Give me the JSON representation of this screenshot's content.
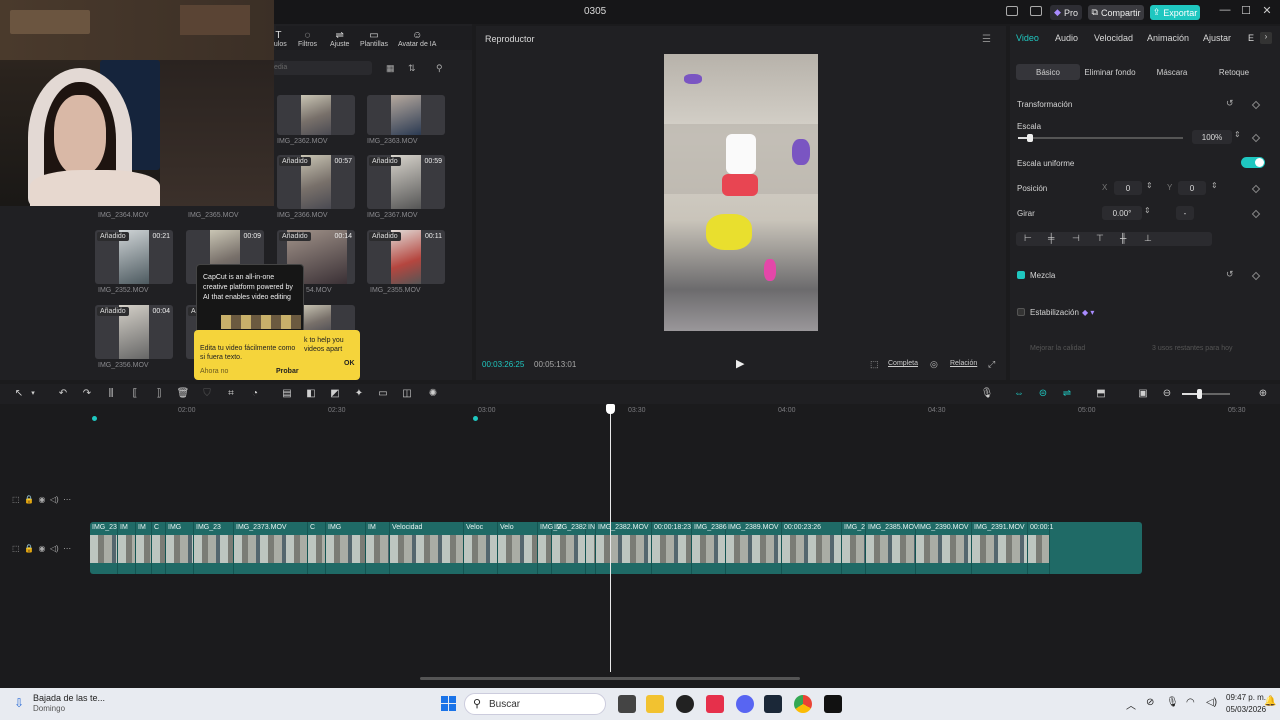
{
  "window": {
    "title": "0305",
    "pro": "Pro",
    "share": "Compartir",
    "export": "Exportar"
  },
  "media_panel": {
    "tools": [
      "ítulos",
      "Filtros",
      "Ajuste",
      "Plantillas",
      "Avatar de IA"
    ],
    "search_placeholder": "edia",
    "items": [
      {
        "name": "IMG_2362.MOV",
        "badge": "",
        "duration": ""
      },
      {
        "name": "IMG_2363.MOV",
        "badge": "",
        "duration": ""
      },
      {
        "name": "IMG_2364.MOV",
        "badge": "",
        "duration": ""
      },
      {
        "name": "IMG_2365.MOV",
        "badge": "",
        "duration": ""
      },
      {
        "name": "IMG_2366.MOV",
        "badge": "Añadido",
        "duration": "00:57"
      },
      {
        "name": "IMG_2367.MOV",
        "badge": "Añadido",
        "duration": "00:59"
      },
      {
        "name": "IMG_2352.MOV",
        "badge": "Añadido",
        "duration": "00:21"
      },
      {
        "name": "",
        "badge": "",
        "duration": "00:09"
      },
      {
        "name": "54.MOV",
        "badge": "Añadido",
        "duration": "00:14"
      },
      {
        "name": "IMG_2355.MOV",
        "badge": "Añadido",
        "duration": "00:11"
      },
      {
        "name": "IMG_2356.MOV",
        "badge": "Añadido",
        "duration": "00:04"
      },
      {
        "name": "",
        "badge": "A",
        "duration": ""
      }
    ]
  },
  "tooltip": {
    "text": "CapCut is an all-in-one creative platform powered by AI that enables video editing",
    "hint": "Edita tu video fácilmente como si fuera texto.",
    "hint_right": "k to help you videos apart",
    "dismiss": "Ahora no",
    "try": "Probar",
    "ok": "OK"
  },
  "player": {
    "title": "Reproductor",
    "current_time": "00:03:26:25",
    "total_time": "00:05:13:01",
    "full_label": "Completa",
    "ratio_label": "Relación"
  },
  "properties": {
    "tabs": [
      "Video",
      "Audio",
      "Velocidad",
      "Animación",
      "Ajustar",
      "E"
    ],
    "subtabs": [
      "Básico",
      "Eliminar fondo",
      "Máscara",
      "Retoque"
    ],
    "transform_label": "Transformación",
    "scale_label": "Escala",
    "scale_value": "100%",
    "scale_fraction": 0.07,
    "uniform_label": "Escala uniforme",
    "position_label": "Posición",
    "x_label": "X",
    "x_value": "0",
    "y_label": "Y",
    "y_value": "0",
    "rotate_label": "Girar",
    "rotate_value": "0.00°",
    "rotate_dash": "-",
    "blend_label": "Mezcla",
    "stabilize_label": "Estabilización",
    "quality_label": "Mejorar la calidad",
    "quality_right": "3 usos restantes para hoy"
  },
  "timeline": {
    "ruler": [
      "02:00",
      "02:30",
      "03:00",
      "03:30",
      "04:00",
      "04:30",
      "05:00",
      "05:30"
    ],
    "clips": [
      "IMG_23",
      "IM",
      "IM",
      "C",
      "IMG",
      "IMG_23",
      "IMG_2373.MOV",
      "C",
      "IMG",
      "IM",
      "Velocidad",
      "Veloc",
      "Velo",
      "IMG_2",
      "IMG_2382",
      "IN",
      "IMG_2382.MOV",
      "00:00:18:23",
      "IMG_2386",
      "IMG_2389.MOV",
      "00:00:23:26",
      "IMG_2",
      "IMG_2385.MOV",
      "IMG_2390.MOV",
      "IMG_2391.MOV",
      "00:00:1"
    ]
  },
  "taskbar": {
    "notification_title": "Bajada de las te...",
    "notification_sub": "Domingo",
    "search": "Buscar",
    "time": "09:47 p. m.",
    "date": "05/03/2026"
  },
  "colors": {
    "accent": "#1fc7c0",
    "track": "#1f6a66",
    "tooltip_yellow": "#f5d43b"
  }
}
